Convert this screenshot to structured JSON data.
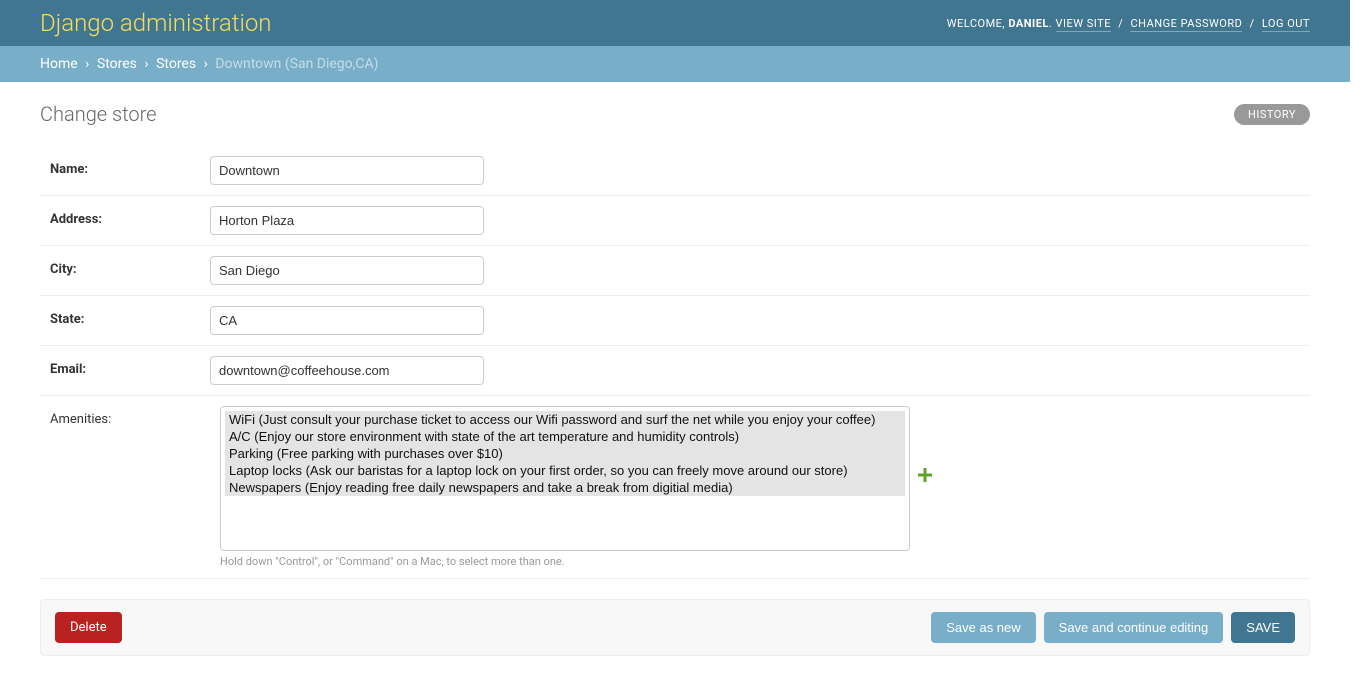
{
  "header": {
    "site_title": "Django administration",
    "welcome": "WELCOME,",
    "username": "DANIEL",
    "view_site": "VIEW SITE",
    "change_password": "CHANGE PASSWORD",
    "log_out": "LOG OUT"
  },
  "breadcrumbs": {
    "home": "Home",
    "app": "Stores",
    "model": "Stores",
    "object": "Downtown (San Diego,CA)"
  },
  "content": {
    "title": "Change store",
    "history": "HISTORY"
  },
  "form": {
    "name": {
      "label": "Name:",
      "value": "Downtown"
    },
    "address": {
      "label": "Address:",
      "value": "Horton Plaza"
    },
    "city": {
      "label": "City:",
      "value": "San Diego"
    },
    "state": {
      "label": "State:",
      "value": "CA"
    },
    "email": {
      "label": "Email:",
      "value": "downtown@coffeehouse.com"
    },
    "amenities": {
      "label": "Amenities:",
      "options": [
        "WiFi (Just consult your purchase ticket to access our Wifi password and surf the net while you enjoy your coffee)",
        "A/C (Enjoy our store environment with state of the art temperature and humidity controls)",
        "Parking (Free parking with purchases over $10)",
        "Laptop locks (Ask our baristas for a laptop lock on your first order, so you can freely move around our store)",
        "Newspapers (Enjoy reading free daily newspapers and take a break from digitial media)"
      ],
      "help": "Hold down \"Control\", or \"Command\" on a Mac, to select more than one."
    }
  },
  "submit": {
    "delete": "Delete",
    "save_as_new": "Save as new",
    "save_continue": "Save and continue editing",
    "save": "SAVE"
  }
}
